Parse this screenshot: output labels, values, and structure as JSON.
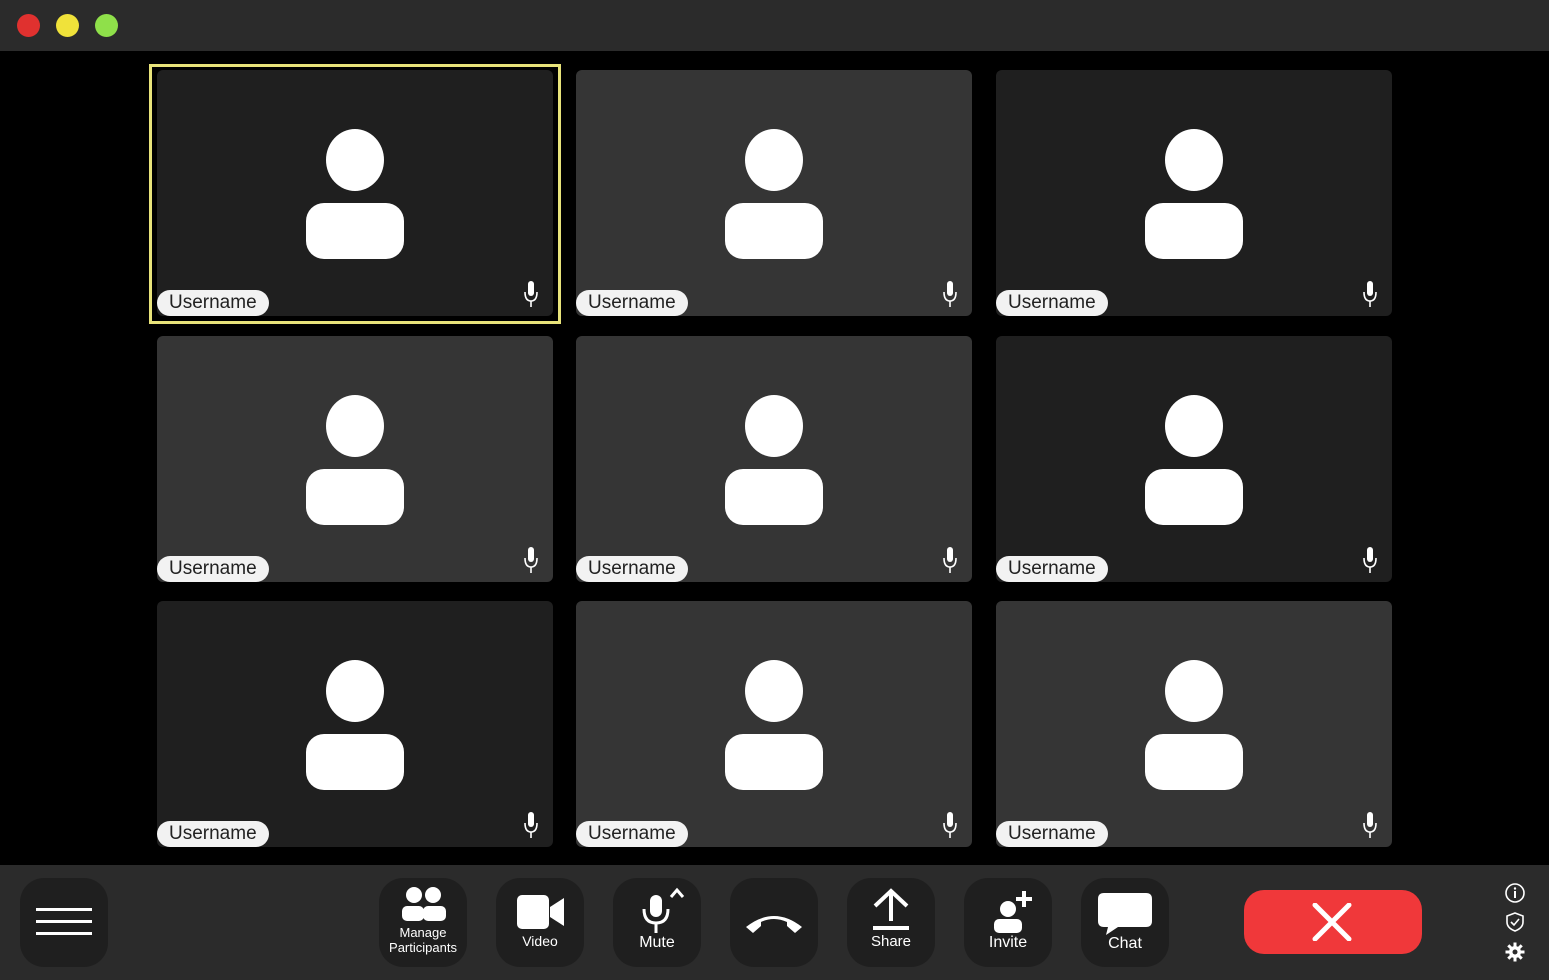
{
  "window": {
    "controls": [
      "close",
      "minimize",
      "maximize"
    ]
  },
  "participants": [
    {
      "name": "Username",
      "tone": "dark",
      "active": true
    },
    {
      "name": "Username",
      "tone": "light",
      "active": false
    },
    {
      "name": "Username",
      "tone": "dark",
      "active": false
    },
    {
      "name": "Username",
      "tone": "light",
      "active": false
    },
    {
      "name": "Username",
      "tone": "light",
      "active": false
    },
    {
      "name": "Username",
      "tone": "dark",
      "active": false
    },
    {
      "name": "Username",
      "tone": "dark",
      "active": false
    },
    {
      "name": "Username",
      "tone": "light",
      "active": false
    },
    {
      "name": "Username",
      "tone": "light",
      "active": false
    }
  ],
  "toolbar": {
    "manage_participants_line1": "Manage",
    "manage_participants_line2": "Participants",
    "video_label": "Video",
    "mute_label": "Mute",
    "share_label": "Share",
    "invite_label": "Invite",
    "chat_label": "Chat"
  },
  "colors": {
    "active_speaker_border": "#e8e37a",
    "leave_button": "#f0383a",
    "close_dot": "#e0312f",
    "minimize_dot": "#f0e23a",
    "maximize_dot": "#8fe04a"
  },
  "icons": [
    "menu-icon",
    "participants-icon",
    "video-camera-icon",
    "microphone-icon",
    "hang-up-icon",
    "share-upload-icon",
    "invite-user-icon",
    "chat-bubble-icon",
    "close-x-icon",
    "info-icon",
    "shield-icon",
    "gear-icon"
  ]
}
